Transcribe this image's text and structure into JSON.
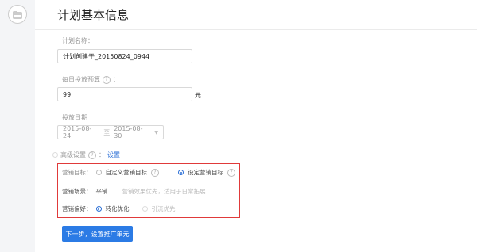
{
  "header": {
    "title": "计划基本信息"
  },
  "plan_name": {
    "label": "计划名称：",
    "value": "计划创建于_20150824_0944"
  },
  "daily_budget": {
    "label": "每日投放预算",
    "value": "99",
    "unit": "元"
  },
  "delivery_date": {
    "label": "投放日期",
    "start": "2015-08-24",
    "separator": "至",
    "end": "2015-08-30"
  },
  "advanced": {
    "label": "高级设置",
    "link": "设置"
  },
  "marketing_goal": {
    "key": "营销目标：",
    "options": [
      {
        "label": "自定义营销目标",
        "selected": false
      },
      {
        "label": "设定营销目标",
        "selected": true
      }
    ]
  },
  "marketing_scene": {
    "key": "营销场景：",
    "value": "平销",
    "desc": "营销效果优先，适用于日常拓展"
  },
  "marketing_preference": {
    "key": "营销偏好：",
    "options": [
      {
        "label": "转化优化",
        "selected": true
      },
      {
        "label": "引流优先",
        "selected": false,
        "disabled": true
      }
    ]
  },
  "next_button": {
    "label": "下一步，设置推广单元"
  },
  "colors": {
    "accent": "#2b7be5",
    "highlight_border": "#e03a3a"
  }
}
